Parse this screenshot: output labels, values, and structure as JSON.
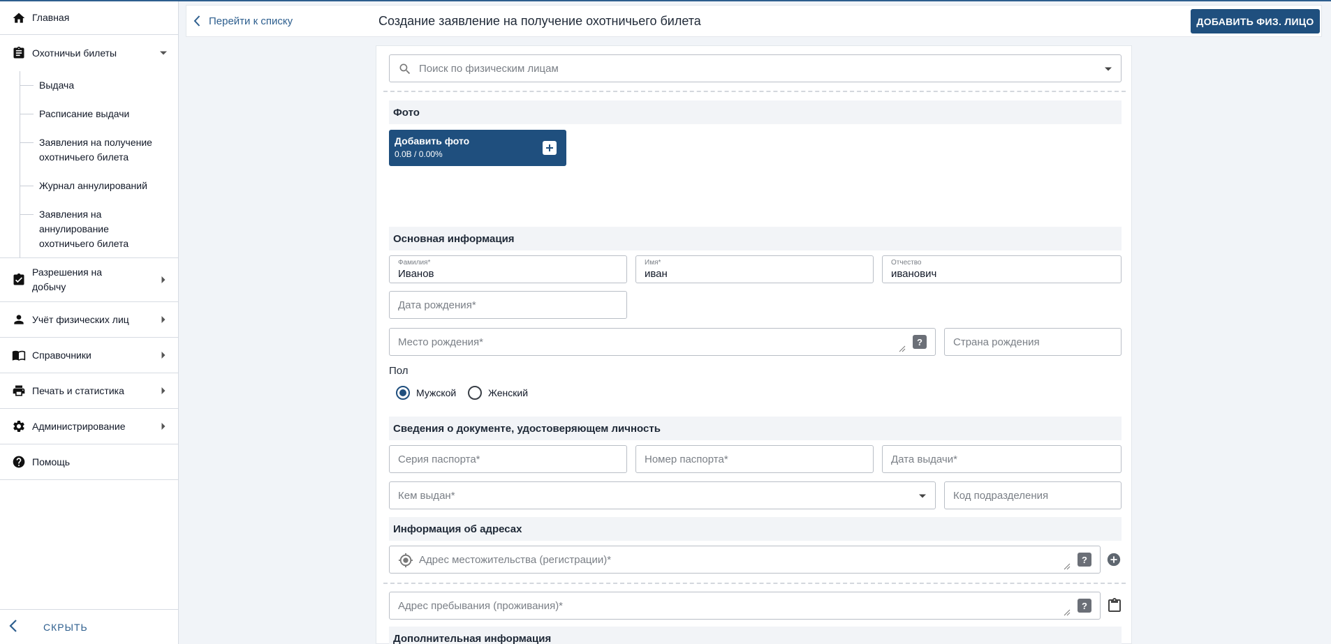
{
  "sidebar": {
    "home": "Главная",
    "hunting_tickets": "Охотничьи билеты",
    "sub_items": [
      "Выдача",
      "Расписание выдачи",
      "Заявления на получение охотничьего билета",
      "Журнал аннулирований",
      "Заявления на аннулирование охотничьего билета"
    ],
    "permits": "Разрешения на добычу",
    "persons": "Учёт физических лиц",
    "references": "Справочники",
    "print_stats": "Печать и статистика",
    "admin": "Администрирование",
    "help": "Помощь",
    "hide": "СКРЫТЬ"
  },
  "header": {
    "back_label": "Перейти к списку",
    "title": "Создание заявление на получение охотничьего билета",
    "add_person_button": "ДОБАВИТЬ ФИЗ. ЛИЦО"
  },
  "form": {
    "search_placeholder": "Поиск по физическим лицам",
    "photo_section": "Фото",
    "add_photo_label": "Добавить фото",
    "add_photo_progress": "0.0B / 0.00%",
    "main_info_section": "Основная информация",
    "surname_label": "Фамилия*",
    "surname_value": "Иванов",
    "name_label": "Имя*",
    "name_value": "иван",
    "patronymic_label": "Отчество",
    "patronymic_value": "иванович",
    "birth_date_placeholder": "Дата рождения*",
    "birth_place_placeholder": "Место рождения*",
    "birth_country_placeholder": "Страна рождения",
    "gender_label": "Пол",
    "gender_male": "Мужской",
    "gender_female": "Женский",
    "gender_selected": "Мужской",
    "id_doc_section": "Сведения о документе, удостоверяющем личность",
    "passport_series_placeholder": "Серия паспорта*",
    "passport_number_placeholder": "Номер паспорта*",
    "issue_date_placeholder": "Дата выдачи*",
    "issued_by_placeholder": "Кем выдан*",
    "division_code_placeholder": "Код подразделения",
    "address_section": "Информация об адресах",
    "residence_address_placeholder": "Адрес местожительства (регистрации)*",
    "stay_address_placeholder": "Адрес пребывания (проживания)*",
    "additional_section": "Дополнительная информация",
    "help_mark": "?"
  },
  "colors": {
    "accent": "#1f4f7e",
    "link": "#2d5e8e"
  }
}
